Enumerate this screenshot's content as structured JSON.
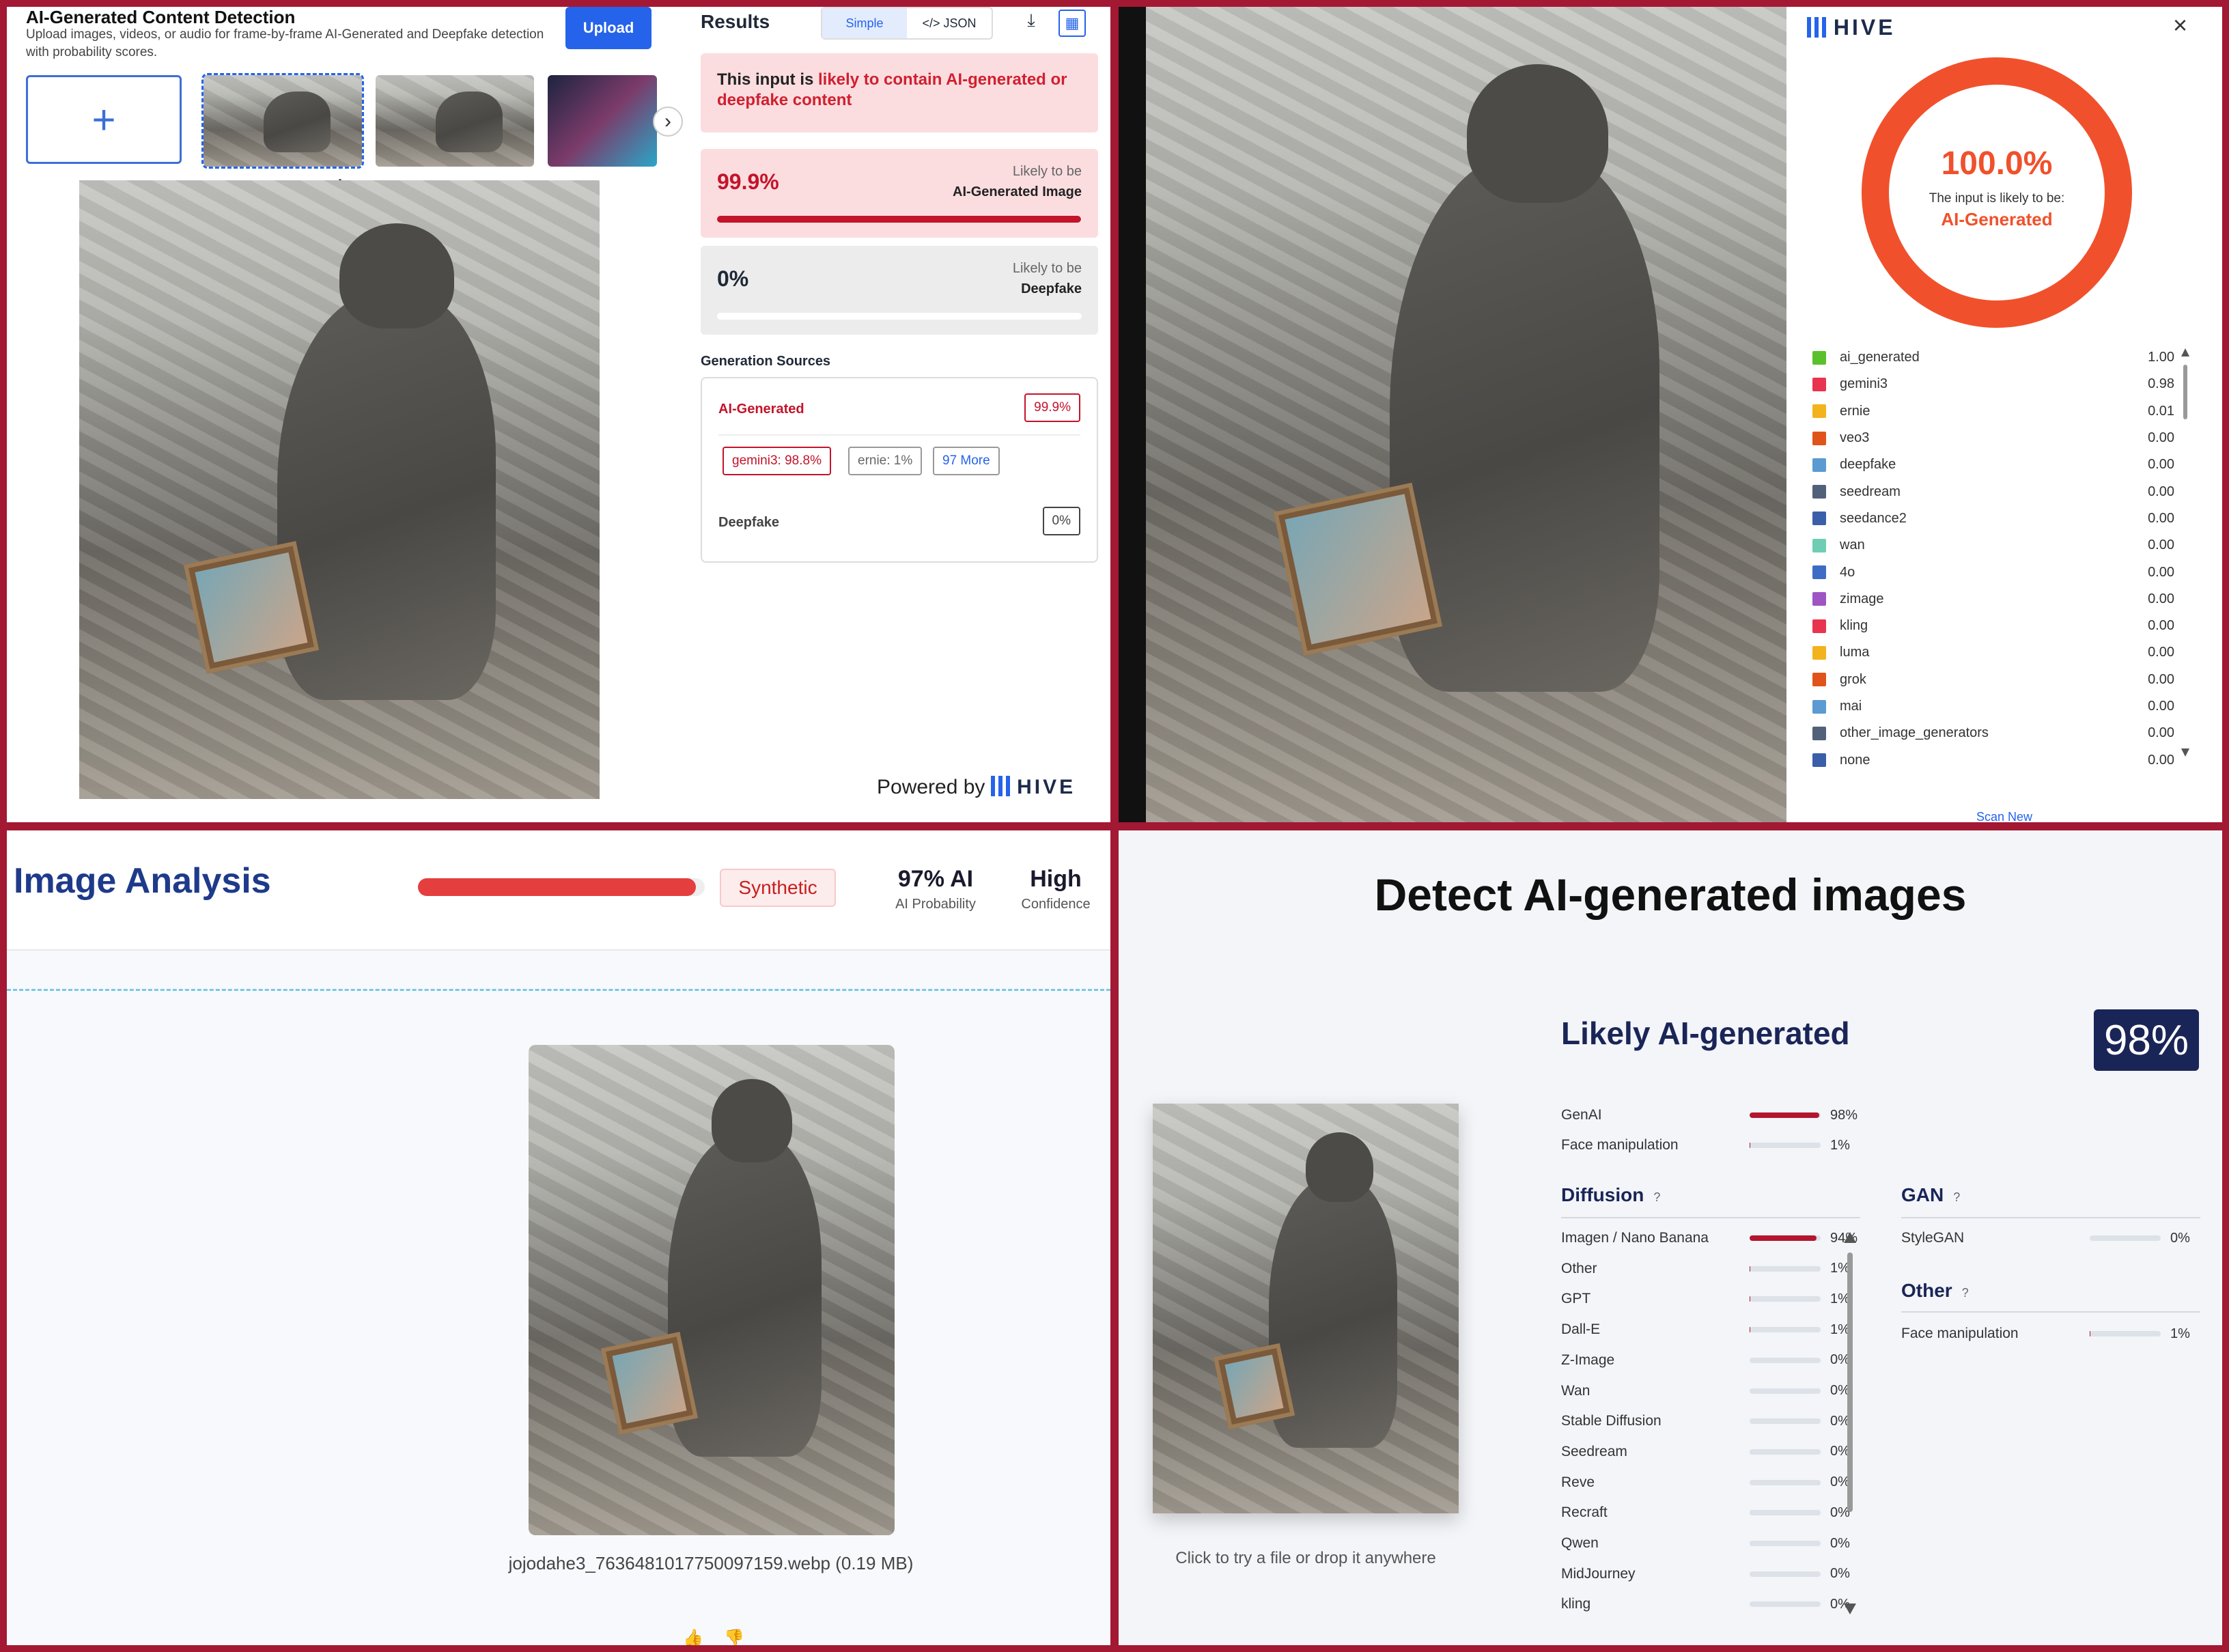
{
  "p1": {
    "title": "AI-Generated Content Detection",
    "subtitle": "Upload images, videos, or audio for frame-by-frame AI-Generated and Deepfake detection with probability scores.",
    "upload_label": "Upload",
    "add_label": "+",
    "next_label": "›",
    "collapse_label": "^",
    "results_label": "Results",
    "toggle_simple": "Simple",
    "toggle_json": "</> JSON",
    "alert_prefix": "This input is ",
    "alert_highlight": "likely to contain AI-generated or deepfake content",
    "score1_pct": "99.9%",
    "score1_l1": "Likely to be",
    "score1_l2": "AI-Generated Image",
    "score1_value": 0.999,
    "score2_pct": "0%",
    "score2_l1": "Likely to be",
    "score2_l2": "Deepfake",
    "score2_value": 0,
    "gen_sources_label": "Generation Sources",
    "ai_label": "AI-Generated",
    "ai_pct": "99.9%",
    "pill1": "gemini3: 98.8%",
    "pill2": "ernie: 1%",
    "pill3": "97 More",
    "deepfake_label": "Deepfake",
    "deepfake_pct": "0%",
    "powered_by": "Powered by",
    "brand": "HIVE"
  },
  "p2": {
    "brand": "HIVE",
    "close": "×",
    "donut_pct": "100.0%",
    "donut_line1": "The input is likely to be:",
    "donut_line2": "AI-Generated",
    "scan_new": "Scan New",
    "classes": [
      {
        "name": "ai_generated",
        "value": "1.00",
        "color": "#5ac12b"
      },
      {
        "name": "gemini3",
        "value": "0.98",
        "color": "#e8344f"
      },
      {
        "name": "ernie",
        "value": "0.01",
        "color": "#f2b31c"
      },
      {
        "name": "veo3",
        "value": "0.00",
        "color": "#e0541b"
      },
      {
        "name": "deepfake",
        "value": "0.00",
        "color": "#5b9bd1"
      },
      {
        "name": "seedream",
        "value": "0.00",
        "color": "#52617a"
      },
      {
        "name": "seedance2",
        "value": "0.00",
        "color": "#3b5ea8"
      },
      {
        "name": "wan",
        "value": "0.00",
        "color": "#6fcdb4"
      },
      {
        "name": "4o",
        "value": "0.00",
        "color": "#3e6cc4"
      },
      {
        "name": "zimage",
        "value": "0.00",
        "color": "#9d55c4"
      },
      {
        "name": "kling",
        "value": "0.00",
        "color": "#e8344f"
      },
      {
        "name": "luma",
        "value": "0.00",
        "color": "#f2b31c"
      },
      {
        "name": "grok",
        "value": "0.00",
        "color": "#e0541b"
      },
      {
        "name": "mai",
        "value": "0.00",
        "color": "#5b9bd1"
      },
      {
        "name": "other_image_generators",
        "value": "0.00",
        "color": "#52617a"
      },
      {
        "name": "none",
        "value": "0.00",
        "color": "#3b5ea8"
      }
    ]
  },
  "p3": {
    "title": "Image Analysis",
    "bar_value": 0.97,
    "badge": "Synthetic",
    "stat1_v": "97% AI",
    "stat1_k": "AI Probability",
    "stat2_v": "High",
    "stat2_k": "Confidence",
    "filename": "jojodahe3_7636481017750097159.webp (0.19 MB)"
  },
  "p4": {
    "title": "Detect AI-generated images",
    "hint": "Click to try a file or drop it anywhere",
    "likely": "Likely AI-generated",
    "pct": "98%",
    "top": [
      {
        "name": "GenAI",
        "value": 0.98,
        "label": "98%"
      },
      {
        "name": "Face manipulation",
        "value": 0.01,
        "label": "1%"
      }
    ],
    "diffusion_label": "Diffusion",
    "gan_label": "GAN",
    "other_label": "Other",
    "help": "?",
    "diffusion": [
      {
        "name": "Imagen / Nano Banana",
        "value": 0.94,
        "label": "94%"
      },
      {
        "name": "Other",
        "value": 0.01,
        "label": "1%"
      },
      {
        "name": "GPT",
        "value": 0.01,
        "label": "1%"
      },
      {
        "name": "Dall-E",
        "value": 0.01,
        "label": "1%"
      },
      {
        "name": "Z-Image",
        "value": 0,
        "label": "0%"
      },
      {
        "name": "Wan",
        "value": 0,
        "label": "0%"
      },
      {
        "name": "Stable Diffusion",
        "value": 0,
        "label": "0%"
      },
      {
        "name": "Seedream",
        "value": 0,
        "label": "0%"
      },
      {
        "name": "Reve",
        "value": 0,
        "label": "0%"
      },
      {
        "name": "Recraft",
        "value": 0,
        "label": "0%"
      },
      {
        "name": "Qwen",
        "value": 0,
        "label": "0%"
      },
      {
        "name": "MidJourney",
        "value": 0,
        "label": "0%"
      },
      {
        "name": "kling",
        "value": 0,
        "label": "0%"
      }
    ],
    "gan": [
      {
        "name": "StyleGAN",
        "value": 0,
        "label": "0%"
      }
    ],
    "other": [
      {
        "name": "Face manipulation",
        "value": 0.01,
        "label": "1%"
      }
    ]
  }
}
